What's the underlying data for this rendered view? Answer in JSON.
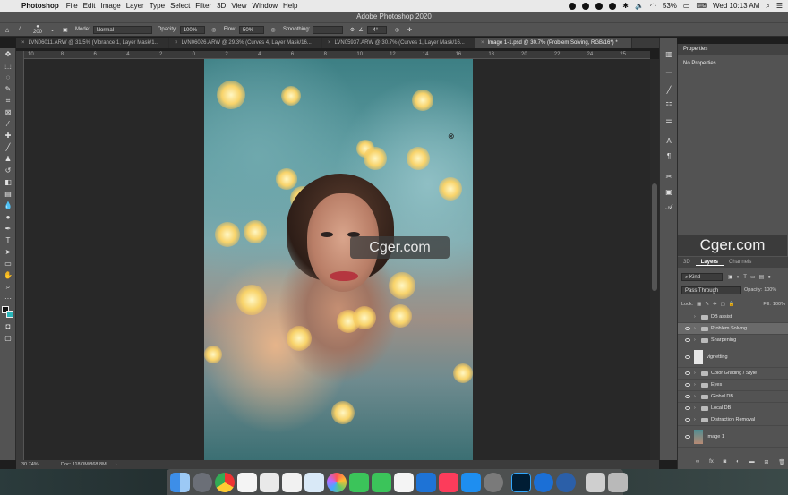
{
  "menubar": {
    "app": "Photoshop",
    "items": [
      "File",
      "Edit",
      "Image",
      "Layer",
      "Type",
      "Select",
      "Filter",
      "3D",
      "View",
      "Window",
      "Help"
    ],
    "battery": "53%",
    "clock": "Wed 10:13 AM"
  },
  "window_title": "Adobe Photoshop 2020",
  "options": {
    "brush_size": "200",
    "mode_label": "Mode:",
    "mode_value": "Normal",
    "opacity_label": "Opacity:",
    "opacity_value": "100%",
    "flow_label": "Flow:",
    "flow_value": "50%",
    "smoothing_label": "Smoothing:",
    "angle_value": "-4°"
  },
  "tabs": [
    {
      "label": "LVN06011.ARW @ 31.5% (Vibrance 1, Layer Mask/1..."
    },
    {
      "label": "LVN06026.ARW @ 29.3% (Curves 4, Layer Mask/16..."
    },
    {
      "label": "LVN05937.ARW @ 30.7% (Curves 1, Layer Mask/16..."
    },
    {
      "label": "Image 1-1.psd @ 30.7% (Problem Solving, RGB/16*) *"
    }
  ],
  "ruler_ticks": [
    "10",
    "8",
    "6",
    "4",
    "2",
    "0",
    "2",
    "4",
    "6",
    "8",
    "10",
    "12",
    "14",
    "16",
    "18",
    "20",
    "22",
    "24",
    "25"
  ],
  "status": {
    "zoom": "30.74%",
    "doc": "Doc: 118.0M/868.8M"
  },
  "watermark": "Cger.com",
  "properties": {
    "title": "Properties",
    "body": "No Properties"
  },
  "layers_panel": {
    "tabs": [
      "3D",
      "Layers",
      "Channels"
    ],
    "kind": "Kind",
    "blend": "Pass Through",
    "opacity_label": "Opacity:",
    "opacity_value": "100%",
    "lock_label": "Lock:",
    "fill_label": "Fill:",
    "fill_value": "100%",
    "layers": [
      {
        "name": "DB assist",
        "visible": false,
        "group": true
      },
      {
        "name": "Problem Solving",
        "visible": true,
        "group": true
      },
      {
        "name": "Sharpening",
        "visible": true,
        "group": true
      },
      {
        "name": "vignetting",
        "visible": true,
        "group": false
      },
      {
        "name": "Color Grading / Style",
        "visible": true,
        "group": true
      },
      {
        "name": "Eyes",
        "visible": true,
        "group": true
      },
      {
        "name": "Global DB",
        "visible": true,
        "group": true
      },
      {
        "name": "Local DB",
        "visible": true,
        "group": true
      },
      {
        "name": "Distraction Removal",
        "visible": true,
        "group": true
      },
      {
        "name": "Image 1",
        "visible": true,
        "group": false
      }
    ]
  },
  "colors": {
    "panel": "#535353",
    "dark": "#282828",
    "selected_layer": "#6a6a6a"
  }
}
